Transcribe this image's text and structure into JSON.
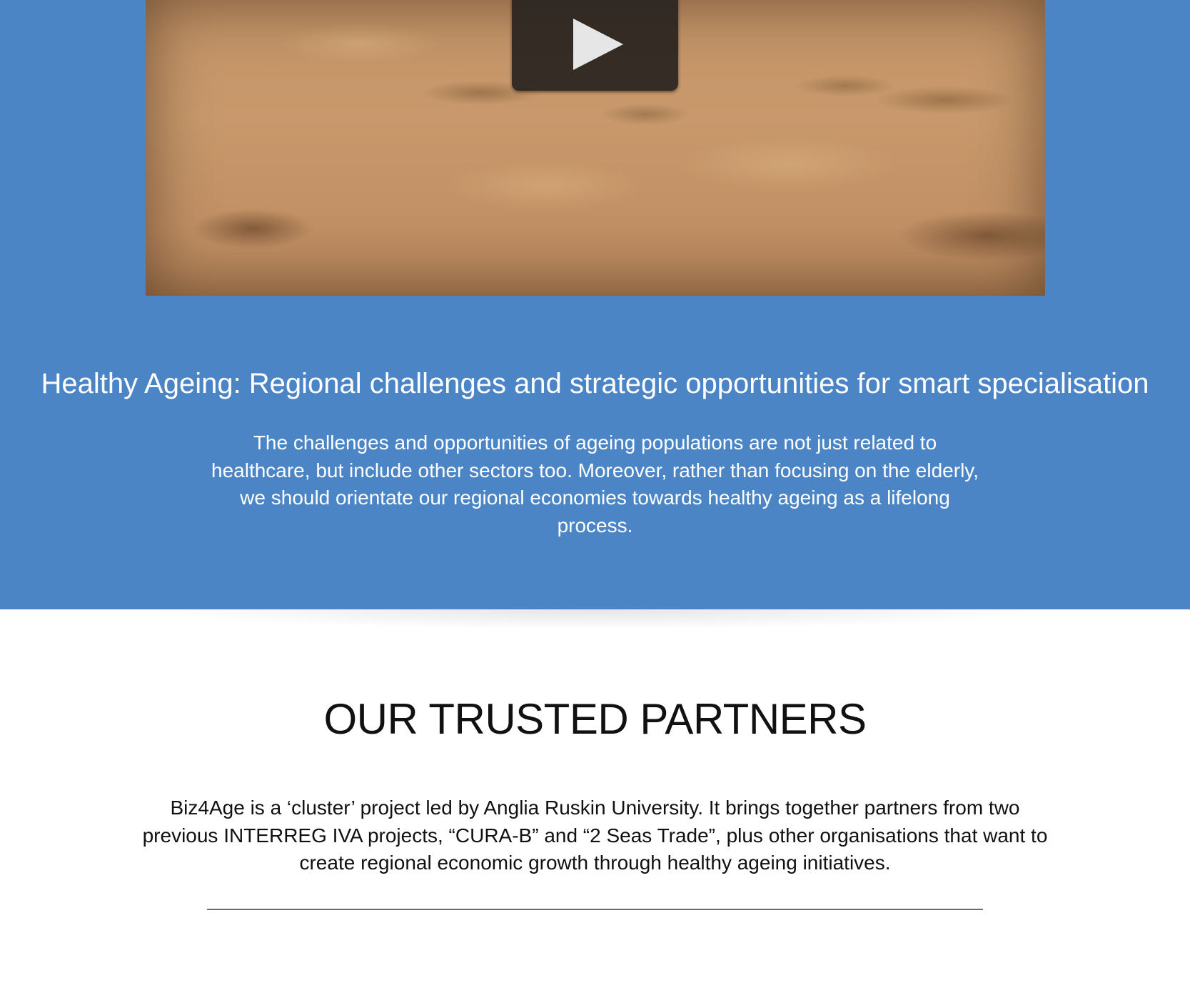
{
  "hero": {
    "video": {
      "play_icon": "play-icon"
    },
    "title": "Healthy Ageing: Regional challenges and strategic opportunities for smart specialisation",
    "description": "The challenges and opportunities of ageing populations are not just related to healthcare, but include other sectors too.  Moreover, rather than focusing on the elderly, we should orientate our regional economies towards healthy ageing as a lifelong process."
  },
  "partners": {
    "heading": "OUR TRUSTED PARTNERS",
    "description": "Biz4Age is a ‘cluster’ project led by Anglia Ruskin University. It brings together partners from two previous INTERREG IVA projects, “CURA-B” and “2 Seas Trade”, plus other organisations that want to create regional economic growth through healthy ageing initiatives."
  },
  "colors": {
    "hero_background": "#4b85c6",
    "hero_text": "#ffffff",
    "body_text": "#111111",
    "divider": "#6a6a6a"
  }
}
